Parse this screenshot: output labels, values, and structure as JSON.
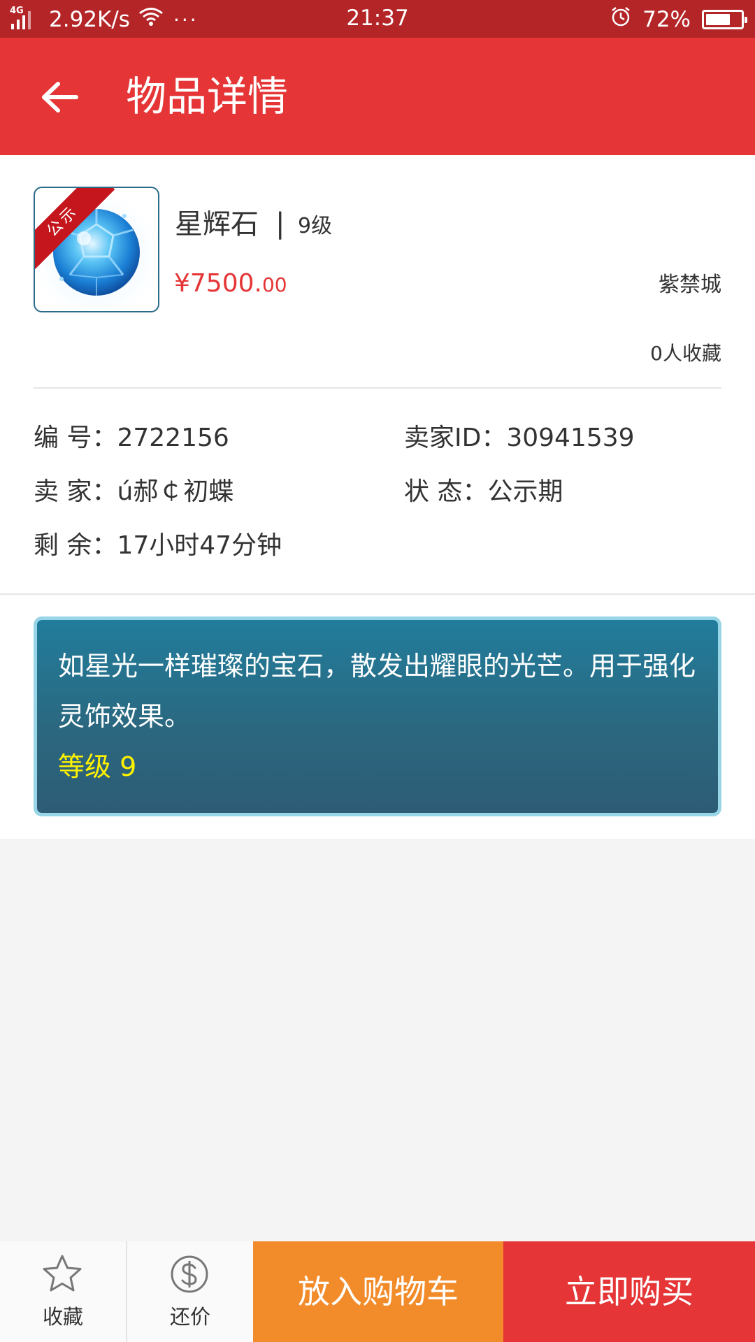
{
  "status_bar": {
    "network": "4G",
    "speed": "2.92K/s",
    "dots": "···",
    "time": "21:37",
    "battery": "72%"
  },
  "app_bar": {
    "title": "物品详情",
    "back_icon": "arrow-left-icon"
  },
  "item": {
    "name": "星辉石",
    "separator": "|",
    "level": "9级",
    "price_main": "¥7500.",
    "price_cents": "00",
    "server": "紫禁城",
    "favorites": "0人收藏",
    "badge": "公示",
    "image_icon": "blue-gem-icon"
  },
  "details": {
    "id_label": "编  号：",
    "id_value": "2722156",
    "seller_id_label": "卖家ID：",
    "seller_id_value": "30941539",
    "seller_label": "卖  家：",
    "seller_value": "ú郝￠初蝶",
    "status_label": "状  态：",
    "status_value": "公示期",
    "remaining_label": "剩  余：",
    "remaining_value": "17小时47分钟"
  },
  "description": {
    "text": "如星光一样璀璨的宝石，散发出耀眼的光芒。用于强化灵饰效果。",
    "level": "等级 9"
  },
  "bottom_bar": {
    "favorite_label": "收藏",
    "favorite_icon": "star-icon",
    "counter_offer_label": "还价",
    "counter_offer_icon": "dollar-circle-icon",
    "cart_label": "放入购物车",
    "buy_label": "立即购买"
  },
  "colors": {
    "status_bar": "#b42528",
    "accent_red": "#e53536",
    "cart_orange": "#f28c2a",
    "description_bg": "#2b6880",
    "description_border": "#98d5e6",
    "level_yellow": "#fff200"
  }
}
